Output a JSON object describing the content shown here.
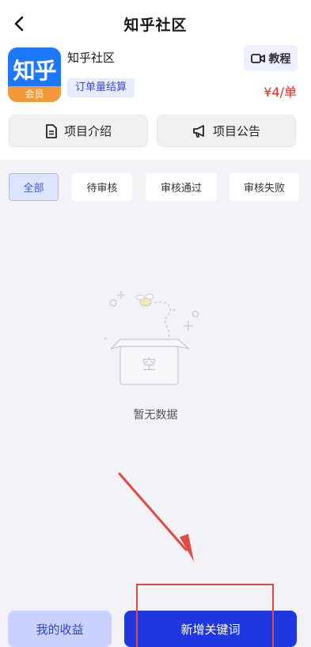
{
  "header": {
    "title": "知乎社区",
    "back_icon": "chevron-left-icon"
  },
  "app": {
    "logo_main": "知乎",
    "logo_sub": "会员",
    "name": "知乎社区",
    "settle_tag": "订单量结算",
    "tutorial_label": "教程",
    "tutorial_icon": "video-camera-icon",
    "price": "¥4/单"
  },
  "actions": {
    "intro_label": "项目介绍",
    "intro_icon": "document-icon",
    "notice_label": "项目公告",
    "notice_icon": "megaphone-icon"
  },
  "filter_tabs": [
    {
      "label": "全部",
      "active": true
    },
    {
      "label": "待审核",
      "active": false
    },
    {
      "label": "审核通过",
      "active": false
    },
    {
      "label": "审核失败",
      "active": false
    }
  ],
  "empty_state": {
    "box_label": "空",
    "message": "暂无数据"
  },
  "bottom": {
    "income_label": "我的收益",
    "add_keyword_label": "新增关键词"
  },
  "colors": {
    "primary": "#1f37e0",
    "secondary_button": "#c9d2ff",
    "price": "#e8291f",
    "annotation": "#e24a3f",
    "content_bg": "#f2f2f7"
  }
}
